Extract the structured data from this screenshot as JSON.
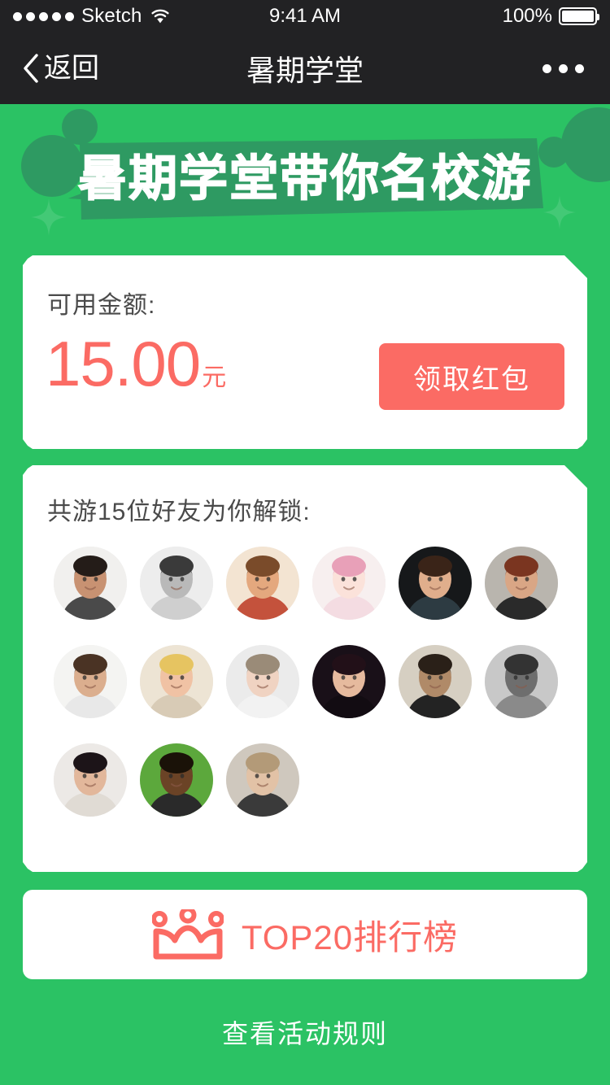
{
  "colors": {
    "brand_green": "#2BC264",
    "banner_band_green": "#2E9A62",
    "coral": "#FB6B64",
    "navbar_dark": "#222224",
    "card_white": "#FFFFFF",
    "text_dark_gray": "#4A4A4A"
  },
  "status_bar": {
    "carrier": "Sketch",
    "time": "9:41 AM",
    "battery_percent": "100%",
    "signal_icon": "signal-dots-icon",
    "wifi_icon": "wifi-icon",
    "battery_icon": "battery-full-icon"
  },
  "nav_bar": {
    "back_label": "返回",
    "back_icon": "chevron-left-icon",
    "title": "暑期学堂",
    "more_icon": "more-horizontal-icon"
  },
  "banner": {
    "headline": "暑期学堂带你名校游",
    "decorations": [
      "circle-large-left",
      "circle-small-left",
      "circle-large-right",
      "circle-small-right",
      "sparkle-left",
      "sparkle-right"
    ]
  },
  "balance_card": {
    "label": "可用金额:",
    "amount": "15.00",
    "unit": "元",
    "claim_button_label": "领取红包"
  },
  "friends_card": {
    "label": "共游15位好友为你解锁:",
    "friend_count": 15,
    "avatars": [
      {
        "id": 1,
        "name": "avatar-friend-1",
        "bg": "#F1F0EE",
        "skin": "#C89272",
        "hair": "#241C18",
        "cloth": "#4A4A4A"
      },
      {
        "id": 2,
        "name": "avatar-friend-2",
        "bg": "#EDEDED",
        "skin": "#B9B9B9",
        "hair": "#3A3A3A",
        "cloth": "#CFCFCF"
      },
      {
        "id": 3,
        "name": "avatar-friend-3",
        "bg": "#F3E4D2",
        "skin": "#E4A87E",
        "hair": "#7A4B2A",
        "cloth": "#C4523C"
      },
      {
        "id": 4,
        "name": "avatar-friend-4",
        "bg": "#F7EFEF",
        "skin": "#FBE2DA",
        "hair": "#E8A0B8",
        "cloth": "#F4DCE2"
      },
      {
        "id": 5,
        "name": "avatar-friend-5",
        "bg": "#16181A",
        "skin": "#E0AE8C",
        "hair": "#3A2418",
        "cloth": "#2D3B42"
      },
      {
        "id": 6,
        "name": "avatar-friend-6",
        "bg": "#B9B5AE",
        "skin": "#D9A685",
        "hair": "#7A3520",
        "cloth": "#2A2A2A"
      },
      {
        "id": 7,
        "name": "avatar-friend-7",
        "bg": "#F4F4F2",
        "skin": "#DBAE8E",
        "hair": "#4A3324",
        "cloth": "#E8E8E8"
      },
      {
        "id": 8,
        "name": "avatar-friend-8",
        "bg": "#EDE4D4",
        "skin": "#F0C2A4",
        "hair": "#E6C461",
        "cloth": "#D8CBB6"
      },
      {
        "id": 9,
        "name": "avatar-friend-9",
        "bg": "#EBEBEB",
        "skin": "#F0D3C2",
        "hair": "#9A8B78",
        "cloth": "#F2F2F2"
      },
      {
        "id": 10,
        "name": "avatar-friend-10",
        "bg": "#191018",
        "skin": "#E6BA9E",
        "hair": "#221018",
        "cloth": "#120C12"
      },
      {
        "id": 11,
        "name": "avatar-friend-11",
        "bg": "#D6CFC2",
        "skin": "#B08A68",
        "hair": "#2A2018",
        "cloth": "#232323"
      },
      {
        "id": 12,
        "name": "avatar-friend-12",
        "bg": "#C8C8C8",
        "skin": "#6E6E6E",
        "hair": "#333333",
        "cloth": "#8A8A8A"
      },
      {
        "id": 13,
        "name": "avatar-friend-13",
        "bg": "#ECE9E6",
        "skin": "#E2B79B",
        "hair": "#1C1418",
        "cloth": "#E0DBD4"
      },
      {
        "id": 14,
        "name": "avatar-friend-14",
        "bg": "#5CA83C",
        "skin": "#6B4326",
        "hair": "#1A1208",
        "cloth": "#2A2A2A"
      },
      {
        "id": 15,
        "name": "avatar-friend-15",
        "bg": "#CFC8BE",
        "skin": "#E2C2A6",
        "hair": "#B39A78",
        "cloth": "#3A3A3A"
      }
    ]
  },
  "top_ranking": {
    "icon": "crown-icon",
    "label": "TOP20排行榜"
  },
  "footer": {
    "rules_link_label": "查看活动规则"
  }
}
